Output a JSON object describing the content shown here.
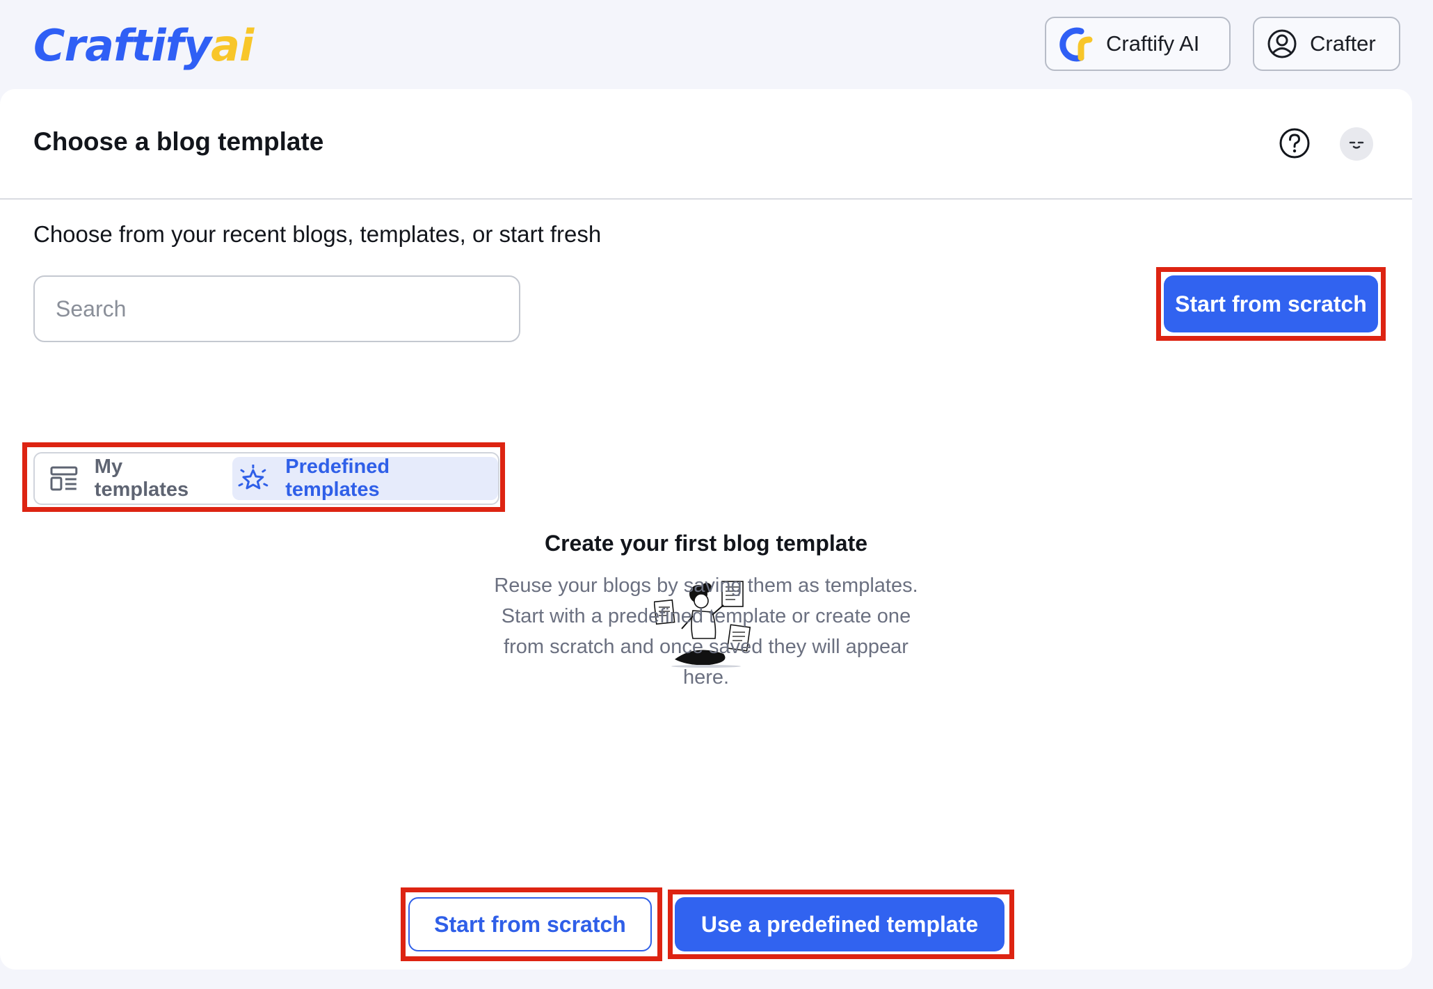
{
  "brand": {
    "logo_main": "Craftify",
    "logo_ai": "ai"
  },
  "header": {
    "craftify_ai_label": "Craftify AI",
    "user_label": "Crafter"
  },
  "page": {
    "title": "Choose a blog template",
    "subtitle": "Choose from your recent blogs, templates, or start fresh"
  },
  "search": {
    "placeholder": "Search"
  },
  "actions": {
    "start_from_scratch": "Start from scratch",
    "use_predefined": "Use a predefined template"
  },
  "tabs": [
    {
      "label": "My templates",
      "icon": "layout-icon",
      "active": false
    },
    {
      "label": "Predefined templates",
      "icon": "sparkle-star-icon",
      "active": true
    }
  ],
  "empty_state": {
    "title": "Create your first blog template",
    "description_lines": [
      "Reuse your blogs by saving them as templates.",
      "Start with a predefined template or create one",
      "from scratch and once saved they will appear",
      "here."
    ]
  },
  "colors": {
    "brand_blue": "#2f5ff5",
    "brand_yellow": "#f8c629",
    "primary_button": "#3163f0",
    "highlight_red": "#dd2412",
    "page_background": "#f4f5fb"
  }
}
